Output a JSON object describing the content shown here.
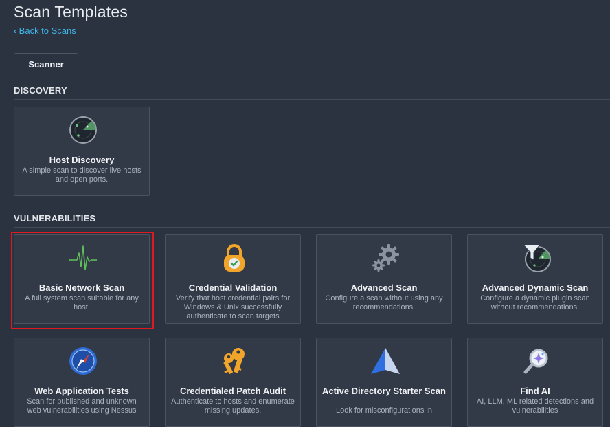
{
  "header": {
    "title": "Scan Templates",
    "back_link": "Back to Scans"
  },
  "tabs": [
    {
      "label": "Scanner",
      "active": true
    }
  ],
  "sections": {
    "discovery": "DISCOVERY",
    "vulnerabilities": "VULNERABILITIES"
  },
  "templates": [
    {
      "title": "Host Discovery",
      "description": "A simple scan to discover live hosts and open ports.",
      "icon": "radar-icon"
    },
    {
      "title": "Basic Network Scan",
      "description": "A full system scan suitable for any host.",
      "icon": "pulse-icon",
      "selected": true
    },
    {
      "title": "Credential Validation",
      "description": "Verify that host credential pairs for Windows & Unix successfully authenticate to scan targets",
      "icon": "padlock-check-icon"
    },
    {
      "title": "Advanced Scan",
      "description": "Configure a scan without using any recommendations.",
      "icon": "gears-icon"
    },
    {
      "title": "Advanced Dynamic Scan",
      "description": "Configure a dynamic plugin scan without recommendations.",
      "icon": "radar-filter-icon"
    },
    {
      "title": "Web Application Tests",
      "description": "Scan for published and unknown web vulnerabilities using Nessus",
      "icon": "compass-icon"
    },
    {
      "title": "Credentialed Patch Audit",
      "description": "Authenticate to hosts and enumerate missing updates.",
      "icon": "keys-icon"
    },
    {
      "title": "Active Directory Starter Scan",
      "description": "Look for misconfigurations in",
      "icon": "pyramid-icon"
    },
    {
      "title": "Find AI",
      "description": "AI, LLM, ML related detections and vulnerabilities",
      "icon": "magnifier-ai-icon"
    }
  ],
  "colors": {
    "background": "#2b3340",
    "card": "#323a47",
    "accent_link": "#3fb4e6",
    "selected_outline": "#e0181f"
  }
}
